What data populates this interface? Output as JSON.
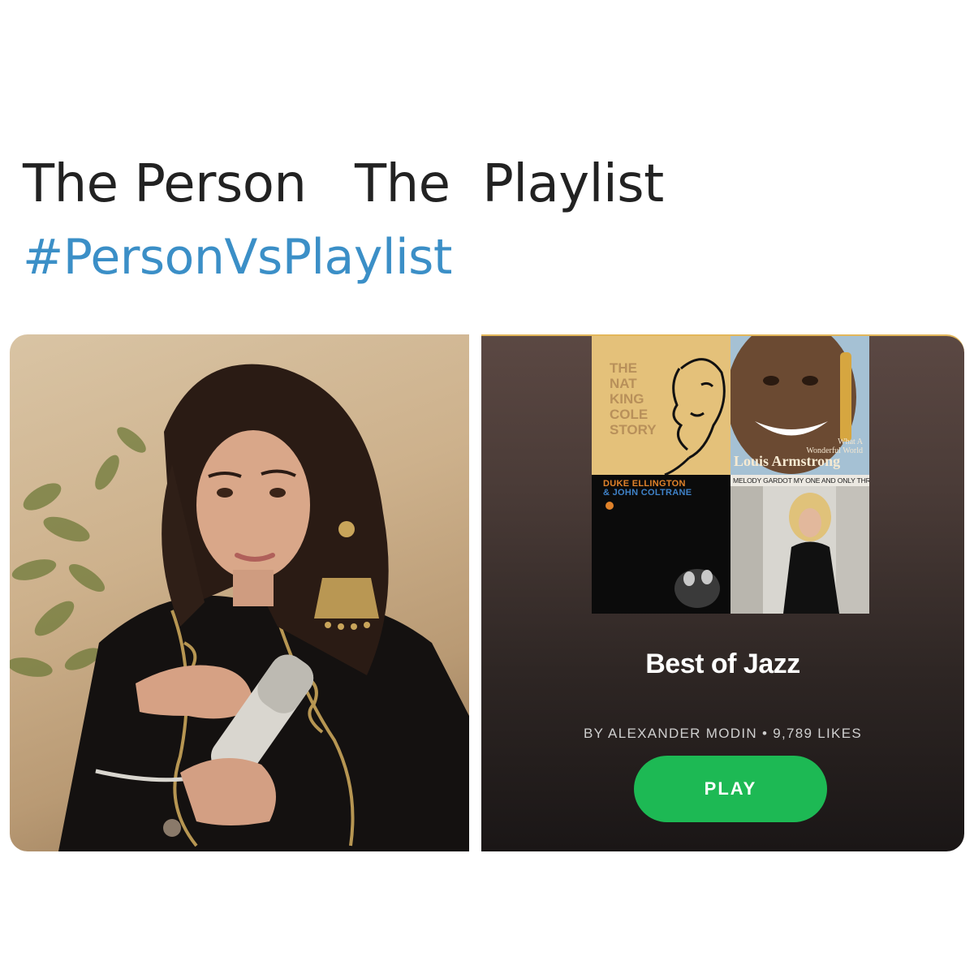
{
  "header": {
    "title": "The Person   The  Playlist",
    "hashtag": "#PersonVsPlaylist"
  },
  "colors": {
    "hashtag": "#3b8fc7",
    "play_button": "#1db954",
    "playlist_bg_top": "#5b4843",
    "playlist_bg_bottom": "#1a1616"
  },
  "playlist": {
    "title": "Best of Jazz",
    "meta": "BY ALEXANDER MODIN • 9,789 LIKES",
    "play_label": "PLAY",
    "covers": {
      "nat_king_cole": [
        "THE",
        "NAT",
        "KING",
        "COLE",
        "STORY"
      ],
      "louis_armstrong_caption_1": "What A",
      "louis_armstrong_caption_2": "Wonderful World",
      "louis_armstrong_name": "Louis Armstrong",
      "duke_ellington_line_1": "DUKE ELLINGTON",
      "duke_ellington_line_2": "& JOHN COLTRANE",
      "melody_gardot": "MELODY GARDOT MY ONE AND ONLY THRILL"
    }
  }
}
